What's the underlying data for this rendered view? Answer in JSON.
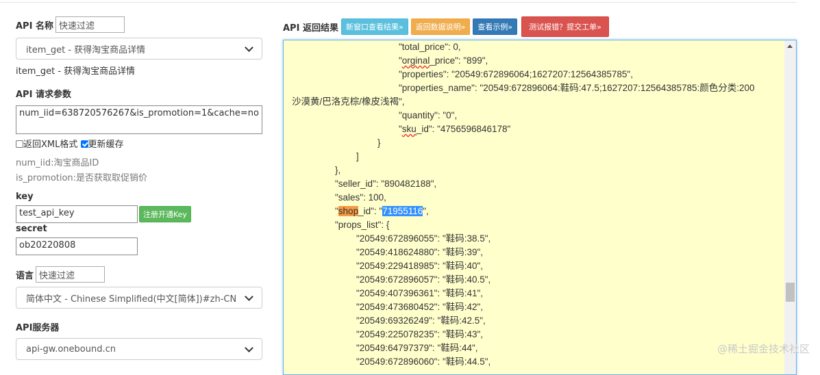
{
  "left": {
    "api_name_label": "API 名称",
    "api_filter_placeholder": "快速过滤",
    "api_select_value": "item_get - 获得淘宝商品详情",
    "api_desc": "item_get - 获得淘宝商品详情",
    "params_label": "API 请求参数",
    "params_value": "num_iid=638720576267&is_promotion=1&cache=no",
    "checkbox_xml_label": "返回XML格式",
    "checkbox_cache_label": "更新缓存",
    "param_help_1": "num_iid:淘宝商品ID",
    "param_help_2": "is_promotion:是否获取取促销价",
    "key_label": "key",
    "key_value": "test_api_key",
    "register_button": "注册开通Key",
    "secret_label": "secret",
    "secret_value": "ob20220808",
    "lang_label": "语言",
    "lang_filter_placeholder": "快速过滤",
    "lang_select_value": "简体中文 - Chinese Simplified(中文[简体])#zh-CN",
    "server_label": "API服务器",
    "server_select_value": "api-gw.onebound.cn"
  },
  "right": {
    "result_label": "API 返回结果",
    "btn_new_window": "新窗口查看结果»",
    "btn_doc": "返回数据说明»",
    "btn_example": "查看示例»",
    "btn_report": "测试报错？提交工单»"
  },
  "code_lines": [
    "\"total_price\": 0,",
    "\"orginal_price\": \"899\",",
    "\"properties\": \"20549:672896064;1627207:12564385785\",",
    "\"properties_name\": \"20549:672896064:鞋码:47.5;1627207:12564385785:颜色分类:200",
    "沙漠黄/巴洛克棕/橡皮浅褐\",",
    "\"quantity\": \"0\",",
    "\"sku_id\": \"4756596846178\"",
    "}",
    "]",
    "},",
    "\"seller_id\": \"890482188\",",
    "\"sales\": 100,",
    "\"shop_id\": \"71955116\",",
    "\"props_list\": {",
    "\"20549:672896055\": \"鞋码:38.5\",",
    "\"20549:418624880\": \"鞋码:39\",",
    "\"20549:229418985\": \"鞋码:40\",",
    "\"20549:672896057\": \"鞋码:40.5\",",
    "\"20549:407396361\": \"鞋码:41\",",
    "\"20549:473680452\": \"鞋码:42\",",
    "\"20549:69326249\": \"鞋码:42.5\",",
    "\"20549:225078235\": \"鞋码:43\",",
    "\"20549:64797379\": \"鞋码:44\",",
    "\"20549:672896060\": \"鞋码:44.5\","
  ],
  "shop_id_parts": {
    "q1": "\"",
    "key_hl": "shop",
    "key_rest": "_id\": \"",
    "val_hl": "71955116",
    "end": "\","
  },
  "watermark": "@稀土掘金技术社区",
  "colors": {
    "info": "#5bc0de",
    "warning": "#f0ad4e",
    "primary": "#337ab7",
    "danger": "#d9534f",
    "success": "#5cb85c",
    "result_bg": "#ffffcc"
  }
}
